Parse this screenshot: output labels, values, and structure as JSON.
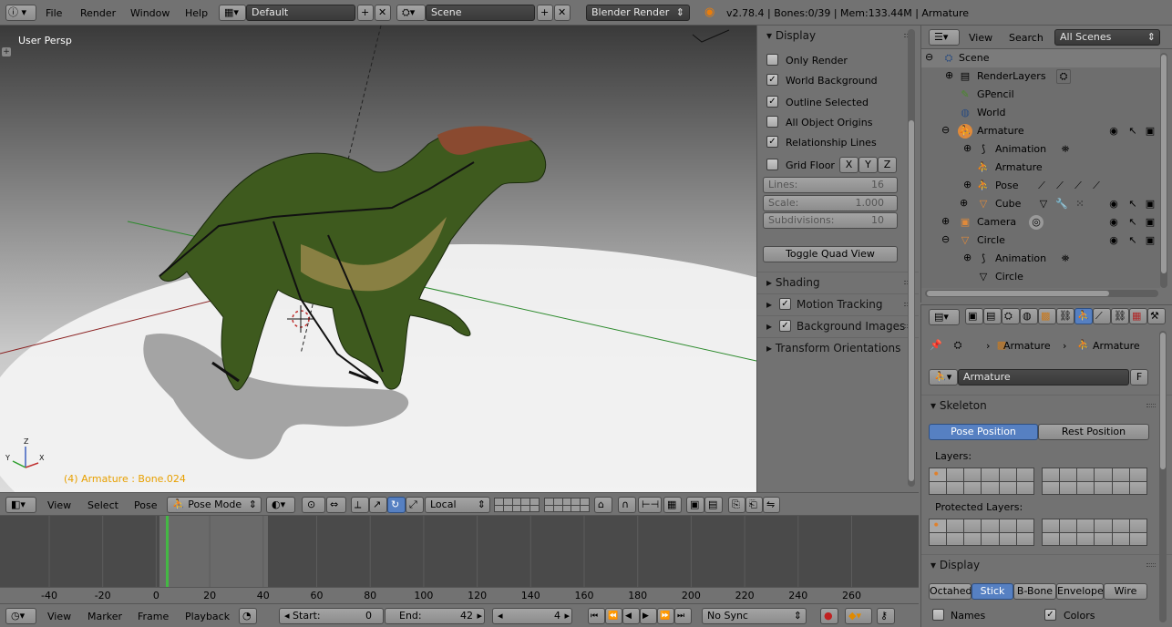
{
  "topbar": {
    "menus": [
      "File",
      "Render",
      "Window",
      "Help"
    ],
    "layout": "Default",
    "scene": "Scene",
    "engine": "Blender Render",
    "info": "v2.78.4 | Bones:0/39 | Mem:133.44M | Armature"
  },
  "viewport": {
    "persp_label": "User Persp",
    "status_label": "(4) Armature : Bone.024",
    "axis_x": "X",
    "axis_y": "Y",
    "axis_z": "Z",
    "header": {
      "view": "View",
      "select": "Select",
      "pose": "Pose",
      "mode": "Pose Mode",
      "orientation": "Local"
    }
  },
  "npanel": {
    "display_title": "Display",
    "only_render": "Only Render",
    "world_background": "World Background",
    "outline_selected": "Outline Selected",
    "all_object_origins": "All Object Origins",
    "relationship_lines": "Relationship Lines",
    "grid_floor": "Grid Floor",
    "x": "X",
    "y": "Y",
    "z": "Z",
    "lines_label": "Lines:",
    "lines_value": "16",
    "scale_label": "Scale:",
    "scale_value": "1.000",
    "subdiv_label": "Subdivisions:",
    "subdiv_value": "10",
    "toggle_quad": "Toggle Quad View",
    "shading": "Shading",
    "motion_tracking": "Motion Tracking",
    "background_images": "Background Images",
    "transform_orientations": "Transform Orientations",
    "checks": {
      "only_render": false,
      "world_background": true,
      "outline_selected": true,
      "all_object_origins": false,
      "relationship_lines": true,
      "grid_floor": false,
      "motion_tracking": true,
      "background_images": true
    }
  },
  "outliner": {
    "view": "View",
    "search": "Search",
    "filter": "All Scenes",
    "items": {
      "scene": "Scene",
      "renderlayers": "RenderLayers",
      "gpencil": "GPencil",
      "world": "World",
      "armature": "Armature",
      "animation": "Animation",
      "armature_data": "Armature",
      "pose": "Pose",
      "cube": "Cube",
      "camera": "Camera",
      "circle": "Circle",
      "circle_animation": "Animation",
      "circle_data": "Circle"
    }
  },
  "properties": {
    "breadcrumb_1": "Armature",
    "breadcrumb_2": "Armature",
    "datablock": "Armature",
    "fake_user": "F",
    "skeleton": "Skeleton",
    "pose_position": "Pose Position",
    "rest_position": "Rest Position",
    "layers_label": "Layers:",
    "protected_label": "Protected Layers:",
    "display": "Display",
    "draw_types": [
      "Octahed",
      "Stick",
      "B-Bone",
      "Envelope",
      "Wire"
    ],
    "active_draw_type": "Stick",
    "names": "Names",
    "colors": "Colors",
    "names_checked": false,
    "colors_checked": true
  },
  "timeline": {
    "ticks": [
      "-40",
      "-20",
      "0",
      "20",
      "40",
      "60",
      "80",
      "100",
      "120",
      "140",
      "160",
      "180",
      "200",
      "220",
      "240",
      "260"
    ],
    "current_frame": 4,
    "view": "View",
    "marker": "Marker",
    "frame": "Frame",
    "playback": "Playback",
    "start_label": "Start:",
    "start_value": "0",
    "end_label": "End:",
    "end_value": "42",
    "current_value": "4",
    "sync": "No Sync"
  }
}
